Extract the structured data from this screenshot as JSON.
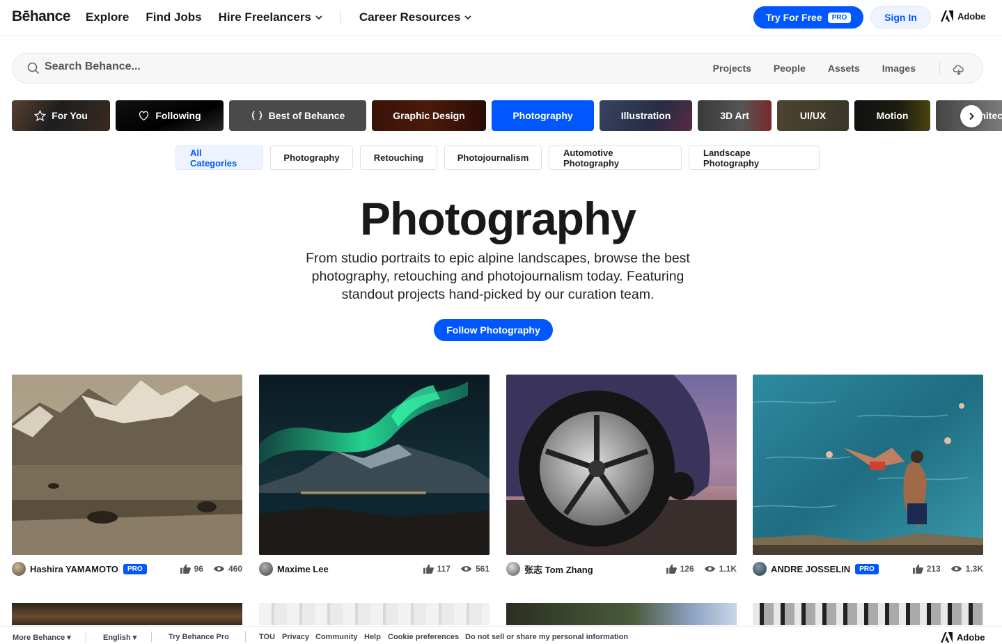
{
  "header": {
    "logo": "Bēhance",
    "nav": [
      "Explore",
      "Find Jobs",
      "Hire Freelancers",
      "Career Resources"
    ],
    "try_label": "Try For Free",
    "pro_badge": "PRO",
    "signin_label": "Sign In",
    "adobe_label": "Adobe"
  },
  "search": {
    "placeholder": "Search Behance...",
    "tabs": [
      "Projects",
      "People",
      "Assets",
      "Images"
    ]
  },
  "categories": [
    "For You",
    "Following",
    "Best of Behance",
    "Graphic Design",
    "Photography",
    "Illustration",
    "3D Art",
    "UI/UX",
    "Motion",
    "Architecture"
  ],
  "active_category": "Photography",
  "subcategories": [
    "All Categories",
    "Photography",
    "Retouching",
    "Photojournalism",
    "Automotive Photography",
    "Landscape Photography"
  ],
  "hero": {
    "title": "Photography",
    "description": "From studio portraits to epic alpine landscapes, browse the best photography, retouching and photojournalism today. Featuring standout projects hand-picked by our curation team.",
    "follow_label": "Follow Photography"
  },
  "projects": [
    {
      "owner": "Hashira YAMAMOTO",
      "pro": true,
      "likes": "96",
      "views": "460"
    },
    {
      "owner": "Maxime Lee",
      "pro": false,
      "likes": "117",
      "views": "561"
    },
    {
      "owner": "张志 Tom Zhang",
      "pro": false,
      "likes": "126",
      "views": "1.1K"
    },
    {
      "owner": "ANDRE JOSSELIN",
      "pro": true,
      "likes": "213",
      "views": "1.3K"
    }
  ],
  "footer": {
    "links": [
      "More Behance",
      "English",
      "Try Behance Pro",
      "TOU",
      "Privacy",
      "Community",
      "Help",
      "Cookie preferences",
      "Do not sell or share my personal information"
    ],
    "adobe_label": "Adobe"
  },
  "colors": {
    "accent": "#0057ff",
    "text": "#191919"
  }
}
